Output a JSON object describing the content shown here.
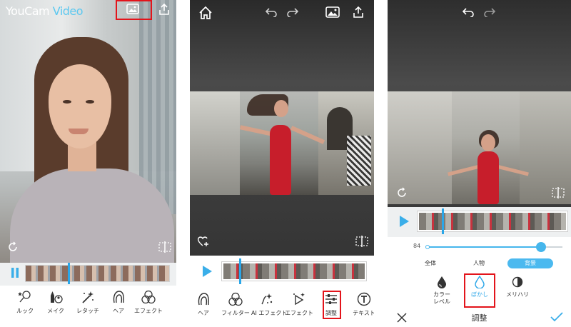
{
  "phone1": {
    "logo_a": "YouCam",
    "logo_b": "Video",
    "tools": [
      {
        "label": "ルック",
        "icon": "look-icon"
      },
      {
        "label": "メイク",
        "icon": "makeup-icon"
      },
      {
        "label": "レタッチ",
        "icon": "retouch-icon"
      },
      {
        "label": "ヘア",
        "icon": "hair-icon"
      },
      {
        "label": "エフェクト",
        "icon": "effect-icon"
      }
    ]
  },
  "phone2": {
    "tools": [
      {
        "label": "ヘア",
        "icon": "hair-icon"
      },
      {
        "label": "フィルター",
        "icon": "filter-icon"
      },
      {
        "label": "AI エフェクト",
        "icon": "ai-effect-icon"
      },
      {
        "label": "エフェクト",
        "icon": "effect-icon"
      },
      {
        "label": "調整",
        "icon": "adjust-icon"
      },
      {
        "label": "テキスト",
        "icon": "text-icon"
      }
    ]
  },
  "phone3": {
    "slider_value": "84",
    "slider_fraction": 0.84,
    "segments": [
      "全体",
      "人物",
      "背景"
    ],
    "active_segment": "背景",
    "options": [
      {
        "label": "カラー\nレベル",
        "icon": "color-level-icon"
      },
      {
        "label": "ぼかし",
        "icon": "blur-icon"
      },
      {
        "label": "メリハリ",
        "icon": "contrast-icon"
      }
    ],
    "title": "調整"
  },
  "colors": {
    "accent": "#2aa6e8",
    "highlight": "#e3141b"
  }
}
